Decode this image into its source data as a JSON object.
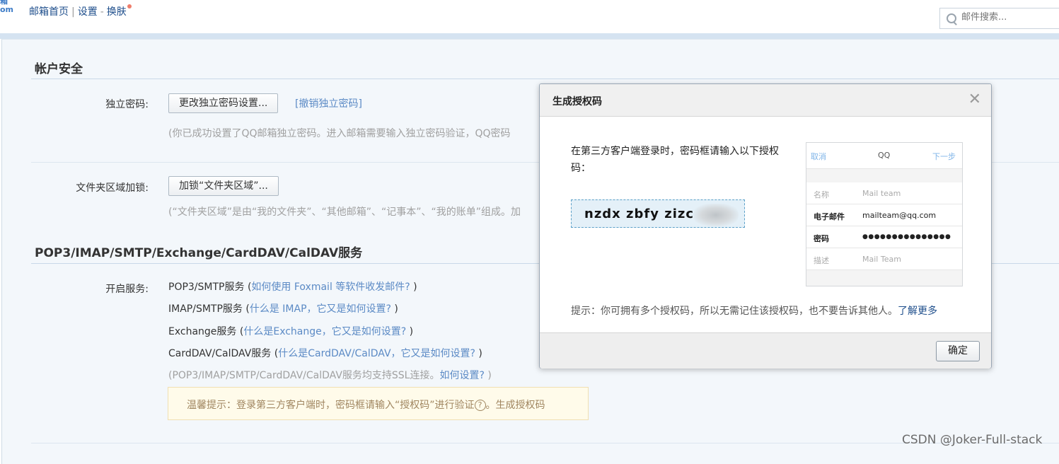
{
  "topbar": {
    "logo_top": "箱",
    "logo_bottom": "om",
    "nav_home": "邮箱首页",
    "nav_sep1": "|",
    "nav_settings": "设置",
    "nav_sep2": "-",
    "nav_skin": "换肤",
    "search_placeholder": "邮件搜索..."
  },
  "account_security": {
    "title": "帐户安全",
    "independent_password_label": "独立密码:",
    "change_password_button": "更改独立密码设置...",
    "revoke_password_link": "[撤销独立密码]",
    "password_note": "(你已成功设置了QQ邮箱独立密码。进入邮箱需要输入独立密码验证，QQ密码",
    "folder_lock_label": "文件夹区域加锁:",
    "folder_lock_button": "加锁“文件夹区域”...",
    "folder_note": "(“文件夹区域”是由“我的文件夹”、“其他邮箱”、“记事本”、“我的账单”组成。加"
  },
  "services": {
    "title": "POP3/IMAP/SMTP/Exchange/CardDAV/CalDAV服务",
    "enable_label": "开启服务:",
    "items": [
      {
        "name": "POP3/SMTP服务",
        "open": " (",
        "link": "如何使用 Foxmail 等软件收发邮件?",
        "close": " )"
      },
      {
        "name": "IMAP/SMTP服务",
        "open": " (",
        "link": "什么是 IMAP，它又是如何设置?",
        "close": " )"
      },
      {
        "name": "Exchange服务",
        "open": " (",
        "link": "什么是Exchange，它又是如何设置?",
        "close": " )"
      },
      {
        "name": "CardDAV/CalDAV服务",
        "open": " (",
        "link": "什么是CardDAV/CalDAV，它又是如何设置?",
        "close": " )"
      }
    ],
    "ssl_note": "(POP3/IMAP/SMTP/CardDAV/CalDAV服务均支持SSL连接。",
    "ssl_link": "如何设置?",
    "ssl_close": " )",
    "tip_text": "温馨提示：登录第三方客户端时，密码框请输入“授权码”进行验证",
    "tip_q": "?",
    "tip_sep": "。",
    "tip_link": "生成授权码"
  },
  "modal": {
    "title": "生成授权码",
    "close": "✕",
    "instruction": "在第三方客户端登录时，密码框请输入以下授权码：",
    "code": "nzdx zbfy zizc",
    "phone": {
      "cancel": "取消",
      "app": "QQ",
      "next": "下一步",
      "name_key": "名称",
      "name_value": "Mail team",
      "email_key": "电子邮件",
      "email_value": "mailteam@qq.com",
      "password_key": "密码",
      "password_value": "●●●●●●●●●●●●●●●",
      "desc_key": "描述",
      "desc_value": "Mail Team"
    },
    "hint": "提示：你可拥有多个授权码，所以无需记住该授权码，也不要告诉其他人。",
    "learn_more": "了解更多",
    "ok_button": "确定"
  },
  "watermark": "CSDN @Joker-Full-stack",
  "colors": {
    "link": "#5b8ac5",
    "nav": "#1f4f8c",
    "panel_bg": "#f3f7fb",
    "tip_bg": "#fffbea"
  }
}
